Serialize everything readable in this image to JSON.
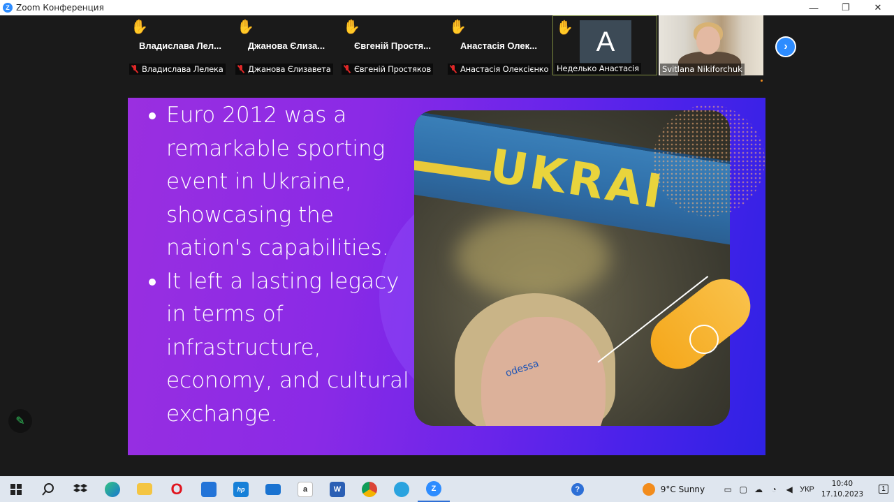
{
  "window": {
    "title": "Zoom Конференция",
    "controls": {
      "minimize": "—",
      "maximize": "❐",
      "close": "✕"
    }
  },
  "participants": [
    {
      "display_name": "Владислава  Лел...",
      "caption": "Владислава Лелека",
      "hand": "✋",
      "muted": true
    },
    {
      "display_name": "Джанова  Єлиза...",
      "caption": "Джанова Єлизавета",
      "hand": "✋",
      "muted": true
    },
    {
      "display_name": "Євгеній  Простя...",
      "caption": "Євгеній Простяков",
      "hand": "✋",
      "muted": true
    },
    {
      "display_name": "Анастасія  Олек...",
      "caption": "Анастасія Олексієнко",
      "hand": "✋",
      "muted": true
    },
    {
      "avatar_letter": "A",
      "caption": "Неделько Анастасія",
      "hand": "✋",
      "active": true
    },
    {
      "caption": "Svitlana Nikiforchuk",
      "video": true
    }
  ],
  "next_page_icon": "chevron-right",
  "slide": {
    "bullets": [
      "Euro 2012 was a remarkable sporting event in Ukraine, showcasing the nation's capabilities.",
      "It left a lasting legacy in terms of infrastructure, economy, and cultural exchange."
    ],
    "photo_scarf_text": "UKRAI",
    "photo_facepaint_text": "odessa",
    "colors": {
      "gradient_start": "#9a2fe0",
      "gradient_end": "#2f22e4",
      "accent": "#f5a81c"
    }
  },
  "annotate_icon": "pencil-icon",
  "taskbar": {
    "apps": [
      "windows-start",
      "search",
      "dropbox",
      "edge",
      "file-explorer",
      "opera",
      "microsoft-store",
      "myhp",
      "mail",
      "amazon",
      "word",
      "chrome",
      "telegram",
      "zoom"
    ],
    "app_glyphs": {
      "word": "W",
      "amazon": "a",
      "myhp": "hp",
      "zoom": "Z",
      "opera": "O"
    },
    "weather": "9°C  Sunny",
    "language": "УКР",
    "time": "10:40",
    "date": "17.10.2023",
    "notification_count": "1"
  }
}
